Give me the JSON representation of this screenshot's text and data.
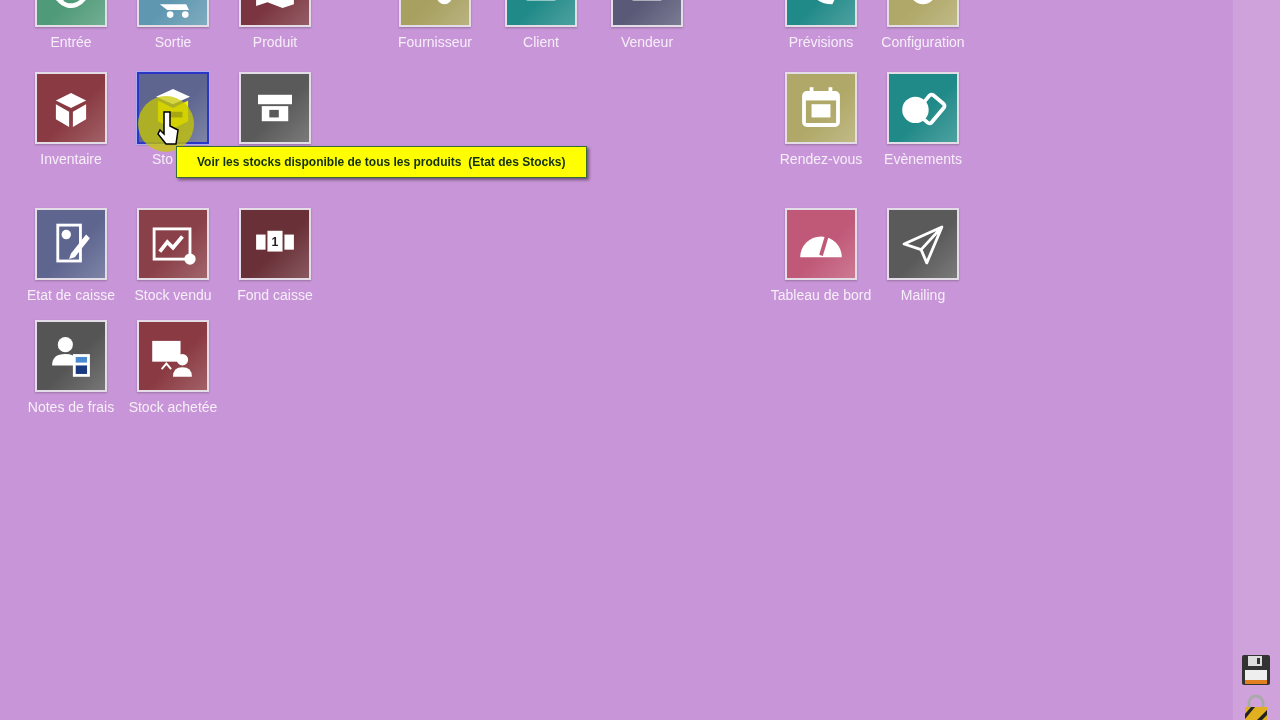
{
  "tile_groups": [
    {
      "rows": [
        [
          {
            "label": "Entrée",
            "color": "#4f9a78",
            "hovered": false
          },
          {
            "label": "Sortie",
            "color": "#5f97b0",
            "hovered": false
          },
          {
            "label": "Produit",
            "color": "#7a3540",
            "hovered": false
          }
        ],
        [
          {
            "label": "Inventaire",
            "color": "#8a3a42",
            "hovered": false
          },
          {
            "label": "Sto",
            "color": "#5e6690",
            "hovered": true,
            "tooltip": "Voir les stocks disponible de tous les produits  (Etat des Stocks)"
          },
          {
            "color": "#5a5a5a",
            "hovered": false
          }
        ],
        [
          {
            "label": "Etat de caisse",
            "color": "#5e6690",
            "hovered": false
          },
          {
            "label": "Stock vendu",
            "color": "#8a4048",
            "hovered": false
          },
          {
            "label": "Fond caisse",
            "color": "#6a3038",
            "hovered": false,
            "icon_text": "1"
          }
        ],
        [
          {
            "label": "Notes de frais",
            "color": "#555555",
            "hovered": false
          },
          {
            "label": "Stock achetée",
            "color": "#8a3a42",
            "hovered": false
          }
        ]
      ]
    },
    {
      "rows": [
        [
          {
            "label": "Fournisseur",
            "color": "#a8a060",
            "hovered": false
          },
          {
            "label": "Client",
            "color": "#1f8a88",
            "hovered": false
          },
          {
            "label": "Vendeur",
            "color": "#5a5a78",
            "hovered": false
          }
        ]
      ]
    },
    {
      "rows": [
        [
          {
            "label": "Prévisions",
            "color": "#1f8a88",
            "hovered": false
          },
          {
            "label": "Configuration",
            "color": "#b0a868",
            "hovered": false
          }
        ],
        [
          {
            "label": "Rendez-vous",
            "color": "#b0a868",
            "hovered": false
          },
          {
            "label": "Evènements",
            "color": "#1f8a88",
            "hovered": false
          }
        ],
        [
          {
            "label": "Tableau de bord",
            "color": "#c05878",
            "hovered": false
          },
          {
            "label": "Mailing",
            "color": "#5a5a5a",
            "hovered": false
          }
        ]
      ]
    }
  ]
}
